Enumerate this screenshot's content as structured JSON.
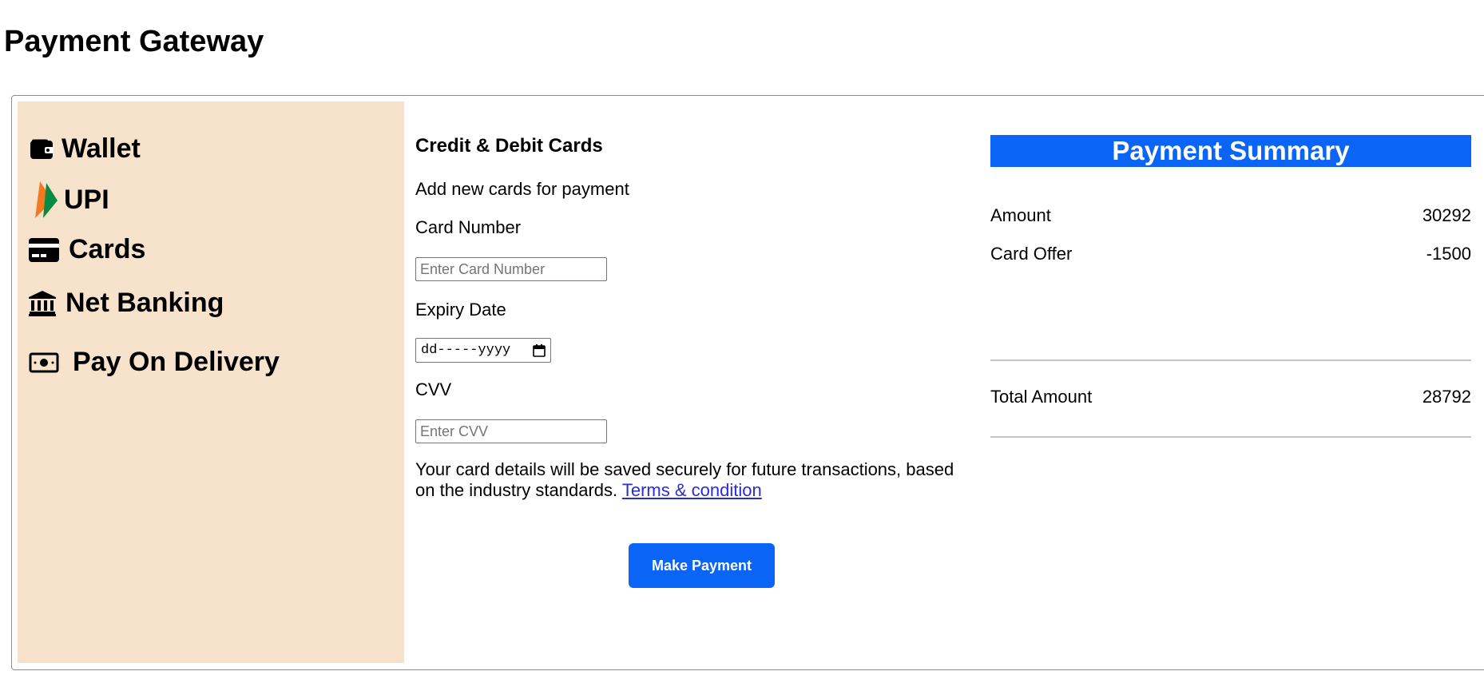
{
  "page": {
    "title": "Payment Gateway"
  },
  "sidebar": {
    "items": [
      {
        "label": "Wallet",
        "icon": "wallet-icon"
      },
      {
        "label": "UPI",
        "icon": "upi-icon"
      },
      {
        "label": "Cards",
        "icon": "credit-card-icon"
      },
      {
        "label": "Net Banking",
        "icon": "bank-icon"
      },
      {
        "label": "Pay On Delivery",
        "icon": "cash-icon"
      }
    ]
  },
  "form": {
    "title": "Credit & Debit Cards",
    "subtitle": "Add new cards for payment",
    "card_number_label": "Card Number",
    "card_number_placeholder": "Enter Card Number",
    "card_number_value": "",
    "expiry_label": "Expiry Date",
    "expiry_placeholder": "dd-----yyyy",
    "cvv_label": "CVV",
    "cvv_placeholder": "Enter CVV",
    "cvv_value": "",
    "note": "Your card details will be saved securely for future transactions, based on the industry standards.",
    "terms_link": "Terms & condition",
    "submit_label": "Make Payment"
  },
  "summary": {
    "title": "Payment Summary",
    "rows": [
      {
        "label": "Amount",
        "value": "30292"
      },
      {
        "label": "Card Offer",
        "value": "-1500"
      }
    ],
    "total": {
      "label": "Total Amount",
      "value": "28792"
    }
  },
  "colors": {
    "accent": "#0a64f5",
    "sidebar_bg": "#f7e3cc",
    "link": "#2b2bd6"
  }
}
